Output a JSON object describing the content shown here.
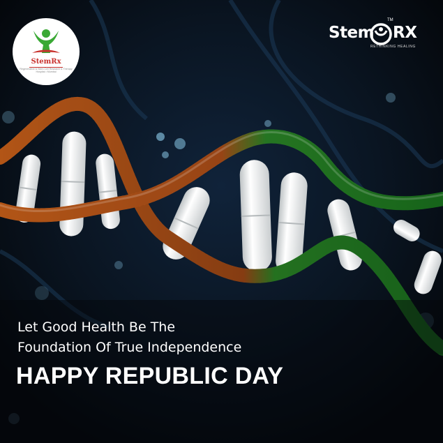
{
  "badge_logo": {
    "name": "StemRx",
    "tagline": "Regenerative & Stem Cell Research & Therapy Hospital • Mumbai"
  },
  "brand_logo": {
    "name_left": "Stem",
    "name_right": "RX",
    "trademark": "TM",
    "tagline": "RETHINKING HEALING"
  },
  "message": {
    "line1": "Let Good Health Be The",
    "line2": "Foundation Of True Independence",
    "headline": "HAPPY REPUBLIC DAY"
  },
  "colors": {
    "background": "#06090d",
    "saffron": "#d9681c",
    "green": "#1f8a22",
    "capsule": "#eef0f0",
    "accent_blue": "#1c3a58",
    "logo_green": "#3aa935",
    "logo_red": "#c8312c"
  }
}
